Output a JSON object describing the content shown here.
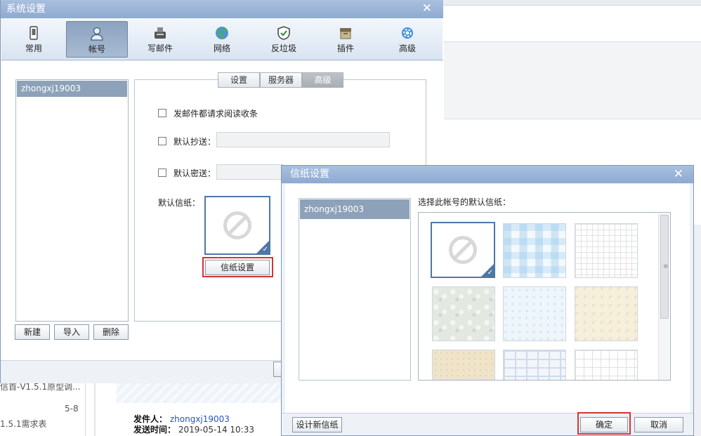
{
  "background": {
    "list_items": [
      {
        "title": "信首-V1.5.1原型调...",
        "date": ""
      },
      {
        "title": "1.5.1需求表",
        "date": "5-8"
      }
    ],
    "message": {
      "sender_label": "发件人：",
      "sender": "zhongxj19003",
      "time_label": "发送时间：",
      "time": "2019-05-14 10:33"
    }
  },
  "system_settings": {
    "title": "系统设置",
    "close": "✕",
    "tabs": [
      {
        "label": "常用",
        "icon": "phone-icon"
      },
      {
        "label": "帐号",
        "icon": "user-icon",
        "selected": true
      },
      {
        "label": "写邮件",
        "icon": "compose-icon"
      },
      {
        "label": "网络",
        "icon": "globe-icon"
      },
      {
        "label": "反垃圾",
        "icon": "shield-icon"
      },
      {
        "label": "插件",
        "icon": "box-icon"
      },
      {
        "label": "高级",
        "icon": "gear-icon"
      }
    ],
    "account": "zhongxj19003",
    "buttons": {
      "new": "新建",
      "import": "导入",
      "delete": "删除"
    },
    "subtabs": [
      "设置",
      "服务器",
      "高级"
    ],
    "options": {
      "read_receipt": "发邮件都请求阅读收条",
      "default_cc": "默认抄送：",
      "default_bcc": "默认密送：",
      "default_paper": "默认信纸："
    },
    "paper_settings_button": "信纸设置"
  },
  "letter_paper": {
    "title": "信纸设置",
    "close": "✕",
    "account": "zhongxj19003",
    "prompt": "选择此帐号的默认信纸：",
    "design_button": "设计新信纸",
    "ok_button": "确定",
    "cancel_button": "取消"
  },
  "colors": {
    "titlebar": "#8eaad1",
    "selection": "#8da2b8",
    "highlight_red": "#d53434",
    "paper_border": "#4e77a7"
  }
}
